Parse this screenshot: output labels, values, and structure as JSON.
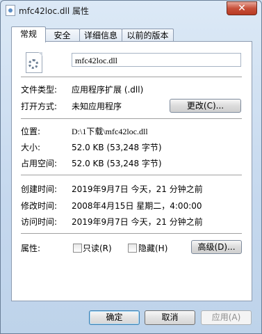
{
  "window": {
    "title": "mfc42loc.dll 属性",
    "close_glyph": "✕"
  },
  "tabs": [
    "常规",
    "安全",
    "详细信息",
    "以前的版本"
  ],
  "general": {
    "file_name": "mfc42loc.dll",
    "file_type_label": "文件类型:",
    "file_type_value": "应用程序扩展 (.dll)",
    "open_with_label": "打开方式:",
    "open_with_value": "未知应用程序",
    "change_button": "更改(C)...",
    "location_label": "位置:",
    "location_value": "D:\\1下载\\mfc42loc.dll",
    "size_label": "大小:",
    "size_value": "52.0 KB (53,248 字节)",
    "size_on_disk_label": "占用空间:",
    "size_on_disk_value": "52.0 KB (53,248 字节)",
    "created_label": "创建时间:",
    "created_value": "2019年9月7日 今天，21 分钟之前",
    "modified_label": "修改时间:",
    "modified_value": "2008年4月15日 星期二，4:00:00",
    "accessed_label": "访问时间:",
    "accessed_value": "2019年9月7日 今天，21 分钟之前",
    "attributes_label": "属性:",
    "readonly_label": "只读(R)",
    "readonly_checked": false,
    "hidden_label": "隐藏(H)",
    "hidden_checked": false,
    "advanced_button": "高级(D)..."
  },
  "footer": {
    "ok": "确定",
    "cancel": "取消",
    "apply": "应用(A)"
  },
  "icons": {
    "file": "dll-file-icon",
    "title": "properties-window-icon"
  }
}
